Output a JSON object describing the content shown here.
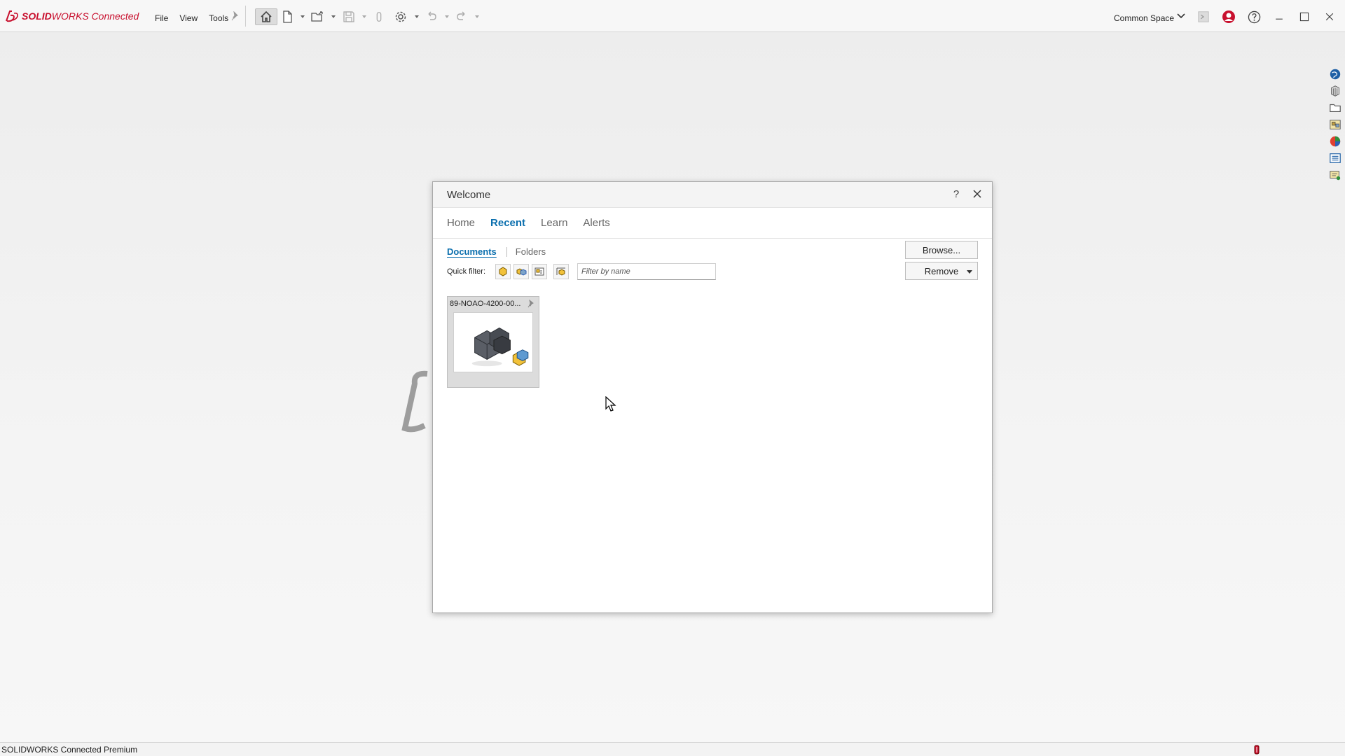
{
  "app": {
    "logo_bold": "SOLID",
    "logo_mid": "WORKS",
    "logo_rest": " Connected",
    "brand_color": "#c8102e",
    "accent_color": "#0b6fae"
  },
  "menu": {
    "items": [
      "File",
      "View",
      "Tools"
    ]
  },
  "toolbar": {
    "icons": [
      "home-icon",
      "new-document-icon",
      "open-icon",
      "save-icon",
      "print-icon",
      "options-icon",
      "undo-icon",
      "redo-icon"
    ]
  },
  "workspace": {
    "label": "Common Space"
  },
  "welcome": {
    "title": "Welcome",
    "help": "?",
    "tabs": [
      {
        "label": "Home",
        "active": false
      },
      {
        "label": "Recent",
        "active": true
      },
      {
        "label": "Learn",
        "active": false
      },
      {
        "label": "Alerts",
        "active": false
      }
    ],
    "subtabs": {
      "documents": "Documents",
      "folders": "Folders"
    },
    "quick_filter_label": "Quick filter:",
    "filter_placeholder": "Filter by name",
    "browse_label": "Browse...",
    "remove_label": "Remove",
    "documents": [
      {
        "name": "89-NOAO-4200-00..."
      }
    ]
  },
  "status": {
    "text": "SOLIDWORKS Connected Premium"
  }
}
